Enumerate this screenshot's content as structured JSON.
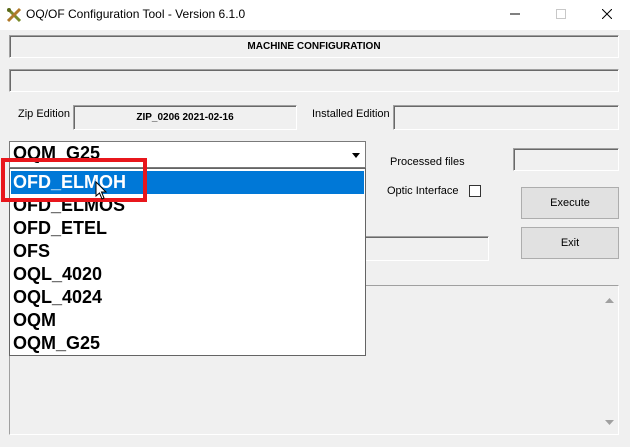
{
  "window": {
    "title": "OQ/OF Configuration Tool -  Version 6.1.0",
    "minimize_icon": "minimize-icon",
    "maximize_icon": "maximize-icon",
    "close_icon": "close-icon"
  },
  "header": {
    "title": "MACHINE CONFIGURATION"
  },
  "editions": {
    "zip_label": "Zip Edition",
    "zip_value": "ZIP_0206 2021-02-16",
    "installed_label": "Installed Edition",
    "installed_value": ""
  },
  "machine_select": {
    "selected": "OQM_G25",
    "options": [
      "OFD_ELMOH",
      "OFD_ELMOS",
      "OFD_ETEL",
      "OFS",
      "OQL_4020",
      "OQL_4024",
      "OQM",
      "OQM_G25"
    ],
    "highlighted": "OFD_ELMOH"
  },
  "processed": {
    "label": "Processed files",
    "value": ""
  },
  "optic": {
    "label": "Optic Interface",
    "checked": false
  },
  "buttons": {
    "execute": "Execute",
    "exit": "Exit"
  },
  "colors": {
    "selection": "#0078d7",
    "annotation": "#e8161c"
  }
}
